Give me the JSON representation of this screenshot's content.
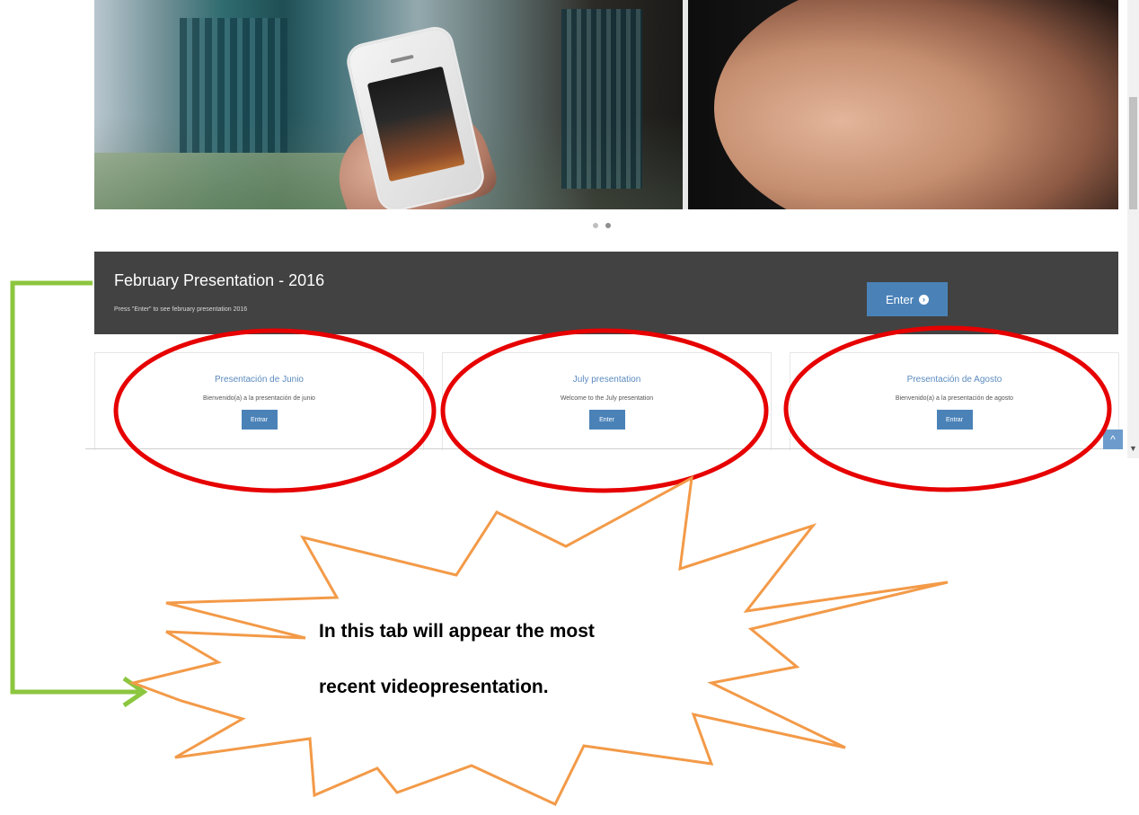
{
  "featured": {
    "title": "February Presentation - 2016",
    "description": "Press \"Enter\" to see february presentation 2016",
    "enter_label": "Enter"
  },
  "cards": [
    {
      "title": "Presentación de Junio",
      "description": "Bienvenido(a) a la presentación de junio",
      "button_label": "Entrar"
    },
    {
      "title": "July presentation",
      "description": "Welcome to the July presentation",
      "button_label": "Enter"
    },
    {
      "title": "Presentación de Agosto",
      "description": "Bienvenido(a) a la presentación de agosto",
      "button_label": "Entrar"
    }
  ],
  "annotation": {
    "line1": "In this tab will appear the most",
    "line2": "recent videopresentation."
  },
  "colors": {
    "featured_bg": "#424242",
    "button_blue": "#4a82b8",
    "card_title_blue": "#5b8bbf",
    "ellipse_red": "#e60000",
    "arrow_green": "#8cc63f",
    "callout_orange": "#f39a48"
  },
  "icons": {
    "enter": "arrow-circle-right-icon",
    "to_top": "chevron-up-icon"
  }
}
